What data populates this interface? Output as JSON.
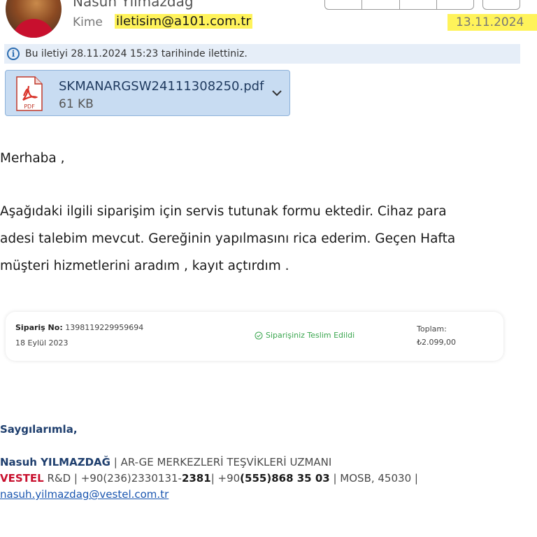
{
  "header": {
    "sender_name": "Nasuh Yılmazdağ",
    "to_label": "Kime",
    "to_value": "iletisim@a101.com.tr",
    "date": "13.11.2024"
  },
  "infobar": {
    "icon": "info-icon",
    "text": "Bu iletiyi 28.11.2024 15:23 tarihinde ilettiniz."
  },
  "attachment": {
    "icon": "pdf-icon",
    "icon_label": "PDF",
    "filename": "SKMANARGSW24111308250.pdf",
    "size": "61 KB"
  },
  "message": {
    "greeting": "Merhaba ,",
    "lines": [
      "Aşağıdaki ilgili siparişim için servis tutunak formu ektedir. Cihaz para",
      "adesi talebim mevcut. Gereğinin yapılmasını rica ederim. Geçen Hafta",
      "müşteri hizmetlerini aradım , kayıt açtırdım ."
    ]
  },
  "order": {
    "order_label": "Sipariş No:",
    "order_no": "1398119229959694",
    "order_date": "18 Eylül 2023",
    "status": "Siparişiniz Teslim Edildi",
    "total_label": "Toplam:",
    "total_value": "₺2.099,00"
  },
  "signature": {
    "closing": "Saygılarımla,",
    "name": "Nasuh YILMAZDAĞ",
    "sep1": " | ",
    "title": "AR-GE MERKEZLERİ TEŞVİKLERİ UZMANI",
    "company": "VESTEL",
    "dept": " R&D | +90(236)2330131-",
    "ext": "2381",
    "sep2": "| +90",
    "mobile": "(555)868 35 03",
    "address": " | MOSB, 45030 |",
    "email": "nasuh.yilmazdag@vestel.com.tr"
  },
  "colors": {
    "highlight": "#fff35a",
    "infobar_bg": "#e6eef8",
    "attachment_bg": "#c8dcf2",
    "signature_blue": "#1f3f6e",
    "brand_red": "#c8102e",
    "delivered_green": "#3aa64f"
  }
}
